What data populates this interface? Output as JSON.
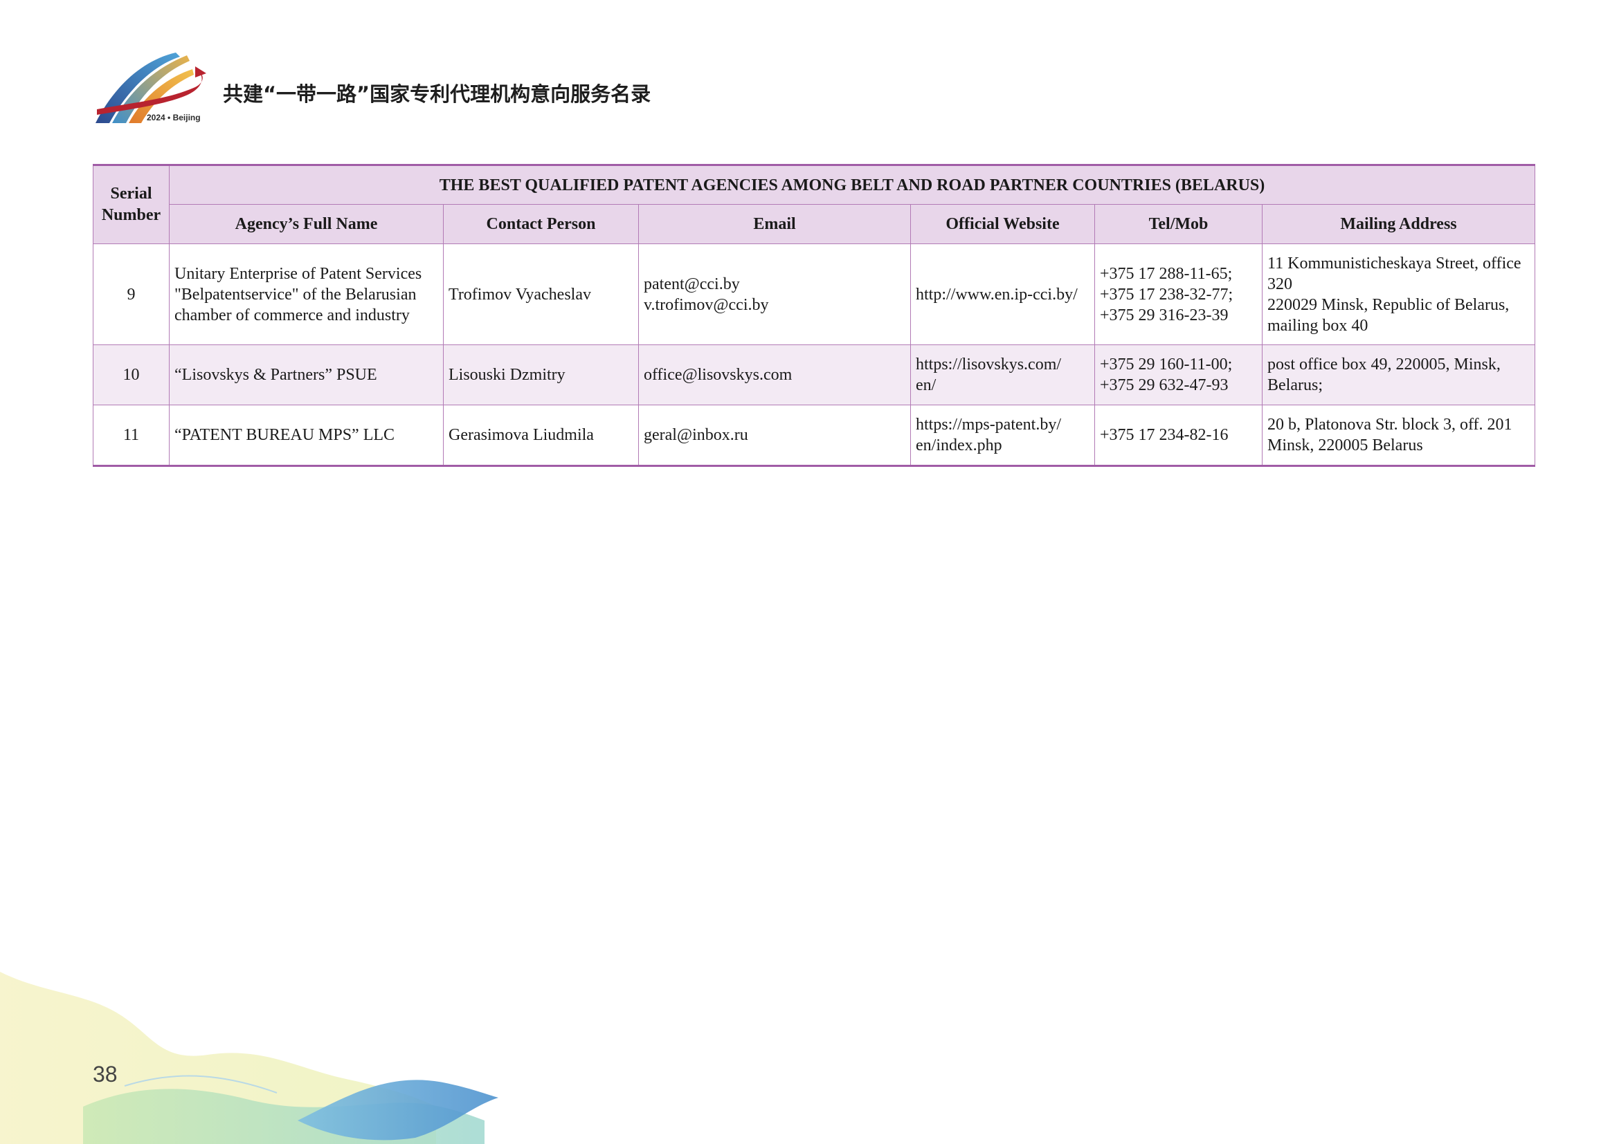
{
  "header": {
    "logo_icon": "belt-and-road-forum-logo-icon",
    "logo_caption": "2024 • Beijing",
    "title": "共建“一带一路”国家专利代理机构意向服务名录"
  },
  "table": {
    "serial_header_line1": "Serial",
    "serial_header_line2": "Number",
    "title": "THE BEST QUALIFIED PATENT AGENCIES AMONG BELT AND ROAD PARTNER COUNTRIES (BELARUS)",
    "columns": [
      "Agency’s Full Name",
      "Contact Person",
      "Email",
      "Official Website",
      "Tel/Mob",
      "Mailing Address"
    ],
    "rows": [
      {
        "serial": "9",
        "agency": [
          "Unitary Enterprise of Patent Services",
          "\"Belpatentservice\" of the Belarusian",
          "chamber of commerce and industry"
        ],
        "contact": "Trofimov Vyacheslav",
        "email": [
          "patent@cci.by",
          "v.trofimov@cci.by"
        ],
        "website": [
          "http://www.en.ip-cci.by/"
        ],
        "tel": [
          "+375 17 288-11-65;",
          "+375 17 238-32-77;",
          "+375 29 316-23-39"
        ],
        "address": [
          "11 Kommunisticheskaya Street, office",
          "320",
          "220029 Minsk, Republic of Belarus,",
          "mailing box 40"
        ]
      },
      {
        "serial": "10",
        "agency": [
          "“Lisovskys & Partners” PSUE"
        ],
        "contact": "Lisouski Dzmitry",
        "email": [
          "office@lisovskys.com"
        ],
        "website": [
          "https://lisovskys.com/",
          "en/"
        ],
        "tel": [
          "+375 29 160-11-00;",
          "+375 29 632-47-93"
        ],
        "address": [
          "post office box 49, 220005, Minsk,",
          "Belarus;"
        ]
      },
      {
        "serial": "11",
        "agency": [
          "“PATENT BUREAU MPS” LLC"
        ],
        "contact": "Gerasimova Liudmila",
        "email": [
          "geral@inbox.ru"
        ],
        "website": [
          "https://mps-patent.by/",
          "en/index.php"
        ],
        "tel": [
          "+375 17 234-82-16"
        ],
        "address": [
          "20 b, Platonova Str. block 3, off. 201",
          "Minsk, 220005 Belarus"
        ]
      }
    ]
  },
  "footer": {
    "page_number": "38",
    "decoration_icon": "wave-decoration-icon"
  },
  "colors": {
    "header_bg": "#e8d6ea",
    "alt_row_bg": "#f3eaf4",
    "border": "#b27ab5",
    "border_strong": "#a05ca6"
  }
}
